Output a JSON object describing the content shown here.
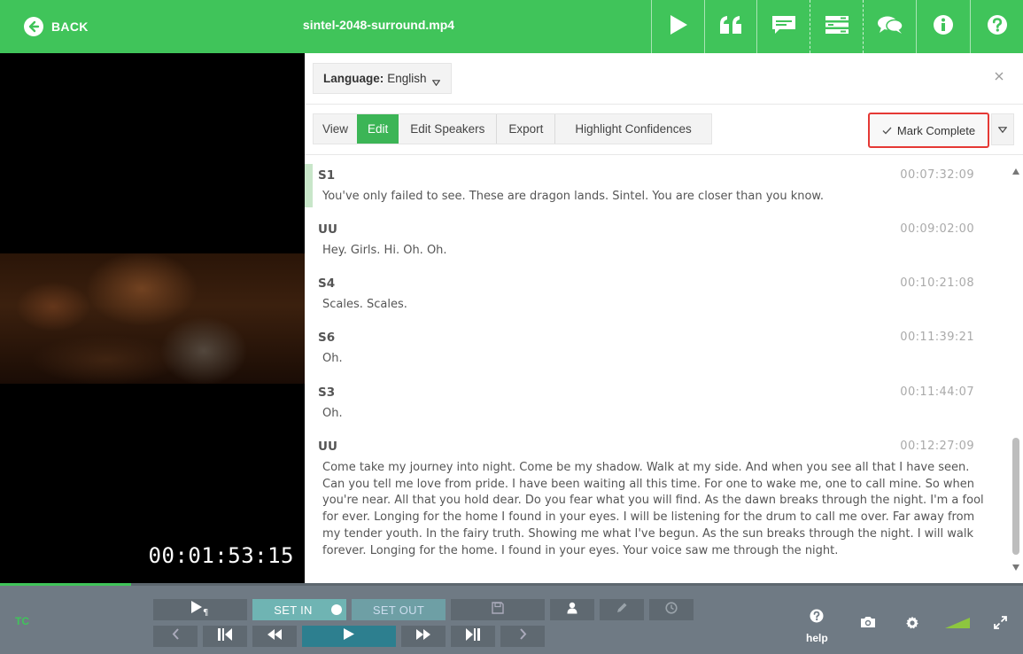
{
  "header": {
    "back_label": "BACK",
    "filename": "sintel-2048-surround.mp4",
    "brand_color": "#40c45a",
    "icons": [
      "play-icon",
      "quote-icon",
      "subtitles-icon",
      "list-icon",
      "comments-icon",
      "info-icon",
      "help-icon"
    ]
  },
  "video": {
    "timecode": "00:01:53:15"
  },
  "language": {
    "label": "Language:",
    "value": "English"
  },
  "tabs": {
    "view": "View",
    "edit": "Edit",
    "edit_speakers": "Edit Speakers",
    "export": "Export",
    "highlight": "Highlight Confidences",
    "mark_complete": "Mark Complete"
  },
  "transcript": [
    {
      "speaker": "S1",
      "time": "00:07:32:09",
      "text": "You've only failed to see. These are dragon lands. Sintel. You are closer than you know."
    },
    {
      "speaker": "UU",
      "time": "00:09:02:00",
      "text": "Hey. Girls. Hi. Oh. Oh."
    },
    {
      "speaker": "S4",
      "time": "00:10:21:08",
      "text": "Scales. Scales."
    },
    {
      "speaker": "S6",
      "time": "00:11:39:21",
      "text": "Oh."
    },
    {
      "speaker": "S3",
      "time": "00:11:44:07",
      "text": "Oh."
    },
    {
      "speaker": "UU",
      "time": "00:12:27:09",
      "text": "Come take my journey into night. Come be my shadow. Walk at my side. And when you see all that I have seen. Can you tell me love from pride. I have been waiting all this time. For one to wake me, one to call mine. So when you're near. All that you hold dear. Do you fear what you will find. As the dawn breaks through the night. I'm a fool for ever. Longing for the home I found in your eyes. I will be listening for the drum to call me over. Far away from my tender youth. In the fairy truth. Showing me what I've begun. As the sun breaks through the night. I will walk forever. Longing for the home. I found in your eyes. Your voice saw me through the night."
    }
  ],
  "controls": {
    "tc_label": "TC",
    "set_in": "SET IN",
    "set_out": "SET OUT",
    "help_label": "help",
    "progress_fraction": 0.128
  }
}
